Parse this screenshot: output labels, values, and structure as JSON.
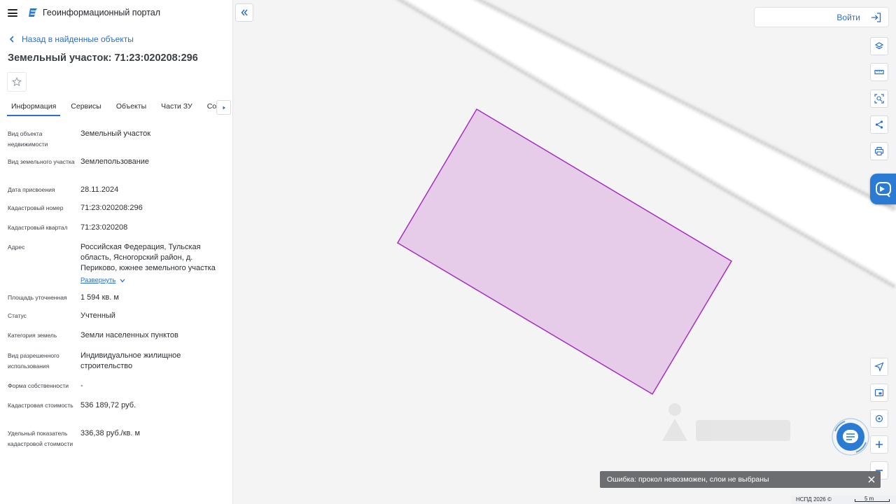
{
  "app": {
    "title": "Геоинформационный портал"
  },
  "nav": {
    "back_label": "Назад в найденные объекты"
  },
  "object": {
    "title": "Земельный участок: 71:23:020208:296"
  },
  "tabs": [
    {
      "label": "Информация",
      "active": true
    },
    {
      "label": "Сервисы"
    },
    {
      "label": "Объекты"
    },
    {
      "label": "Части ЗУ"
    },
    {
      "label": "Состав"
    }
  ],
  "info_rows": [
    {
      "label": "Вид объекта недвижимости",
      "value": "Земельный участок"
    },
    {
      "label": "Вид земельного участка",
      "value": "Землепользование"
    },
    {
      "label": "Дата присвоения",
      "value": "28.11.2024"
    },
    {
      "label": "Кадастровый номер",
      "value": "71:23:020208:296"
    },
    {
      "label": "Кадастровый квартал",
      "value": "71:23:020208"
    },
    {
      "label": "Адрес",
      "value": "Российская Федерация, Тульская область, Ясногорский район, д. Периково, южнее земельного участка",
      "expand_label": "Развернуть"
    },
    {
      "label": "Площадь уточненная",
      "value": "1 594 кв. м"
    },
    {
      "label": "Статус",
      "value": "Учтенный"
    },
    {
      "label": "Категория земель",
      "value": "Земли населенных пунктов"
    },
    {
      "label": "Вид разрешенного использования",
      "value": "Индивидуальное жилищное строительство"
    },
    {
      "label": "Форма собственности",
      "value": "-"
    },
    {
      "label": "Кадастровая стоимость",
      "value": "536 189,72 руб."
    },
    {
      "label": "Удельный показатель кадастровой стоимости",
      "value": "336,38 руб./кв. м"
    }
  ],
  "map": {
    "login_label": "Войти",
    "toolbar_icons": [
      "layers-icon",
      "ruler-icon",
      "select-area-icon",
      "share-icon",
      "print-icon"
    ],
    "bottom_icons": [
      "navigate-icon",
      "minimap-icon",
      "locate-icon",
      "zoom-in-icon",
      "zoom-out-icon"
    ],
    "parcel_fill": "#e6cce9",
    "parcel_stroke": "#a530bd",
    "accent": "#2a7bd3",
    "toast_message": "Ошибка: прокол невозможен, слои не выбраны",
    "footer_copyright": "НСПД 2026 ©",
    "scale_label": "5 m"
  }
}
